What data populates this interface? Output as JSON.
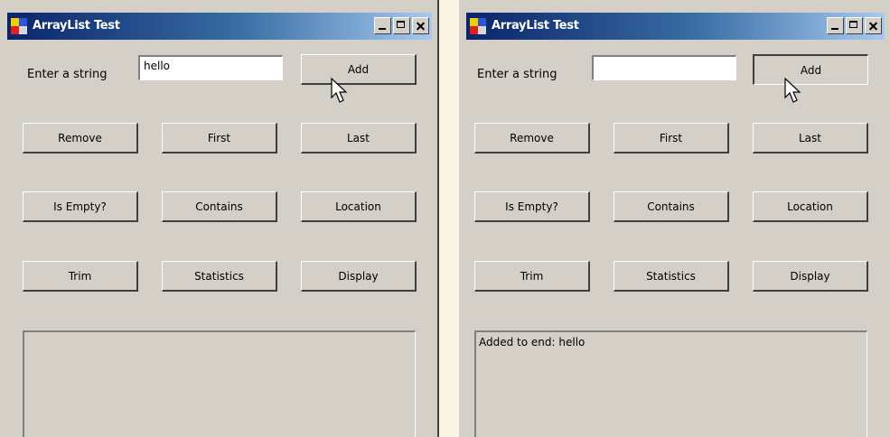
{
  "window_title": "ArrayList Test",
  "labels": {
    "enter_string": "Enter a string"
  },
  "buttons": {
    "add": "Add",
    "remove": "Remove",
    "first": "First",
    "last": "Last",
    "is_empty": "Is Empty?",
    "contains": "Contains",
    "location": "Location",
    "trim": "Trim",
    "statistics": "Statistics",
    "display": "Display"
  },
  "left_window": {
    "input_value": "hello",
    "output_text": ""
  },
  "right_window": {
    "input_value": "",
    "output_text": "Added to end: hello"
  },
  "colors": {
    "window_face": "#d4d0c8",
    "titlebar_start": "#0a246a",
    "titlebar_end": "#a6caf0",
    "page_background": "#fdf5e3"
  },
  "icons": [
    "app-icon",
    "minimize-icon",
    "maximize-icon",
    "close-icon",
    "mouse-cursor-icon"
  ]
}
